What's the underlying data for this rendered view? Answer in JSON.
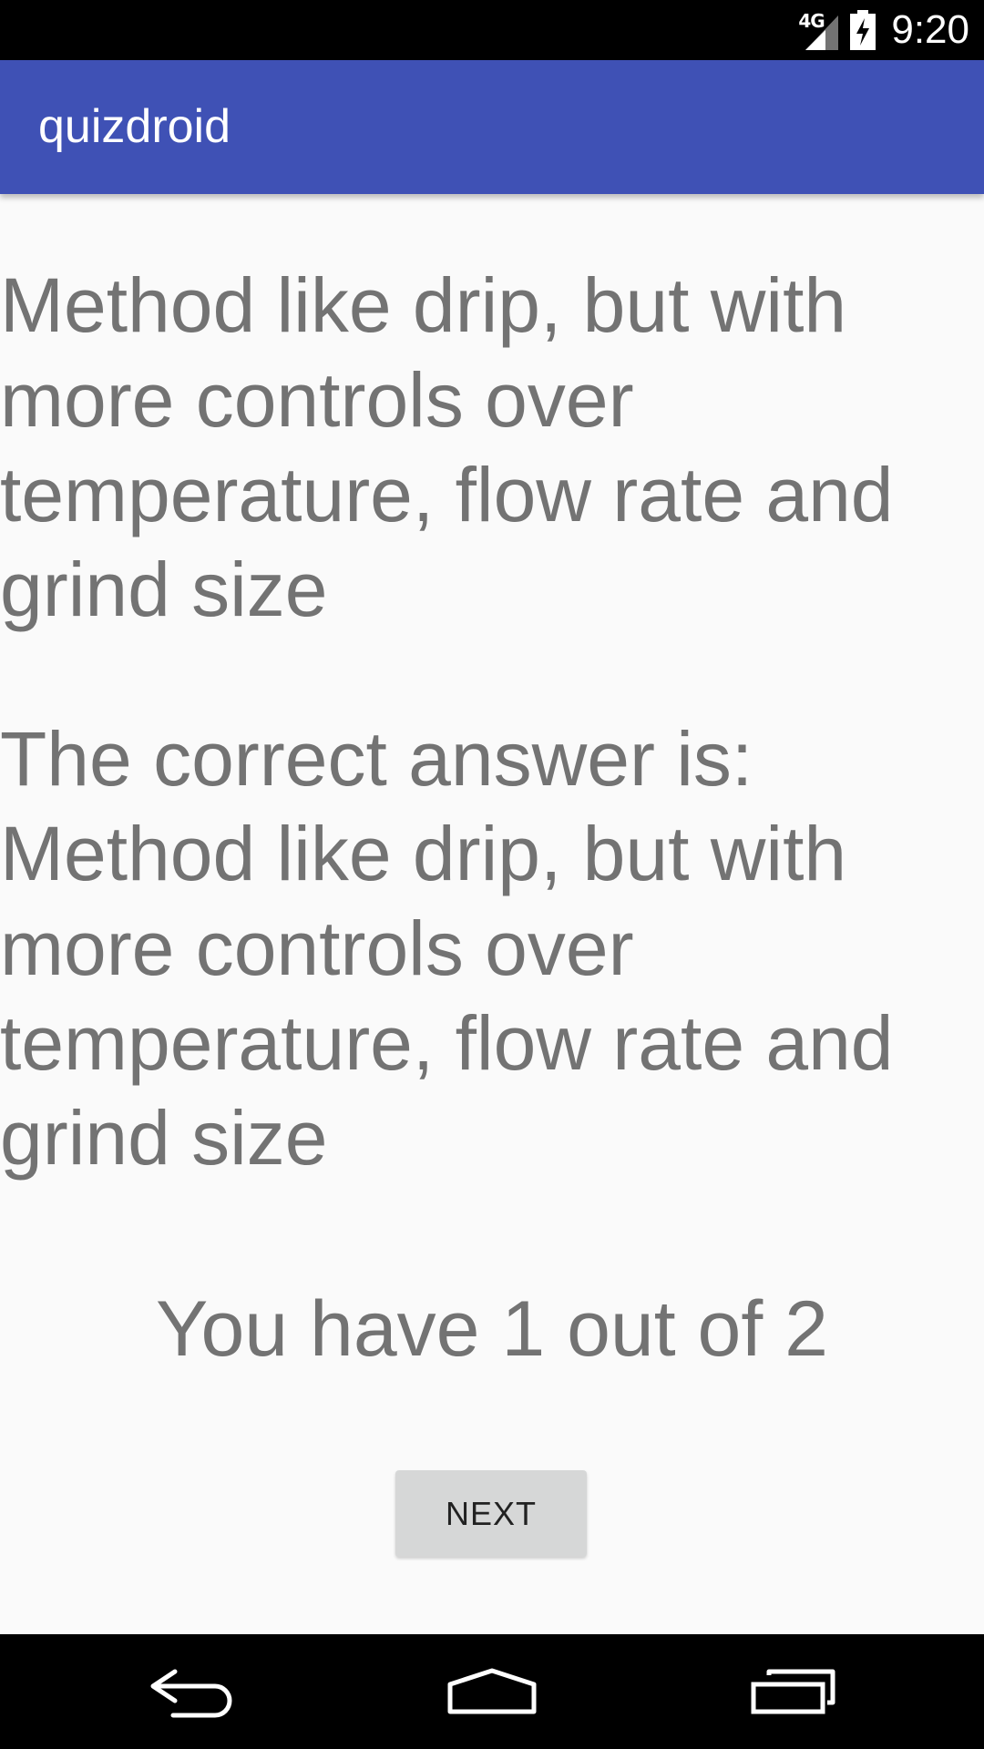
{
  "status_bar": {
    "network": "4G",
    "time": "9:20",
    "icons": [
      "signal-icon",
      "battery-charging-icon"
    ]
  },
  "app_bar": {
    "title": "quizdroid"
  },
  "quiz": {
    "question": "Method like drip, but with more controls over temperature, flow rate and grind size",
    "answer_prefix": "The correct answer is:",
    "answer": "Method like drip, but with more controls over temperature, flow rate and grind size",
    "score": "You have 1 out of 2",
    "next_label": "NEXT"
  },
  "nav_bar": {
    "icons": [
      "back-icon",
      "home-icon",
      "recents-icon"
    ]
  }
}
